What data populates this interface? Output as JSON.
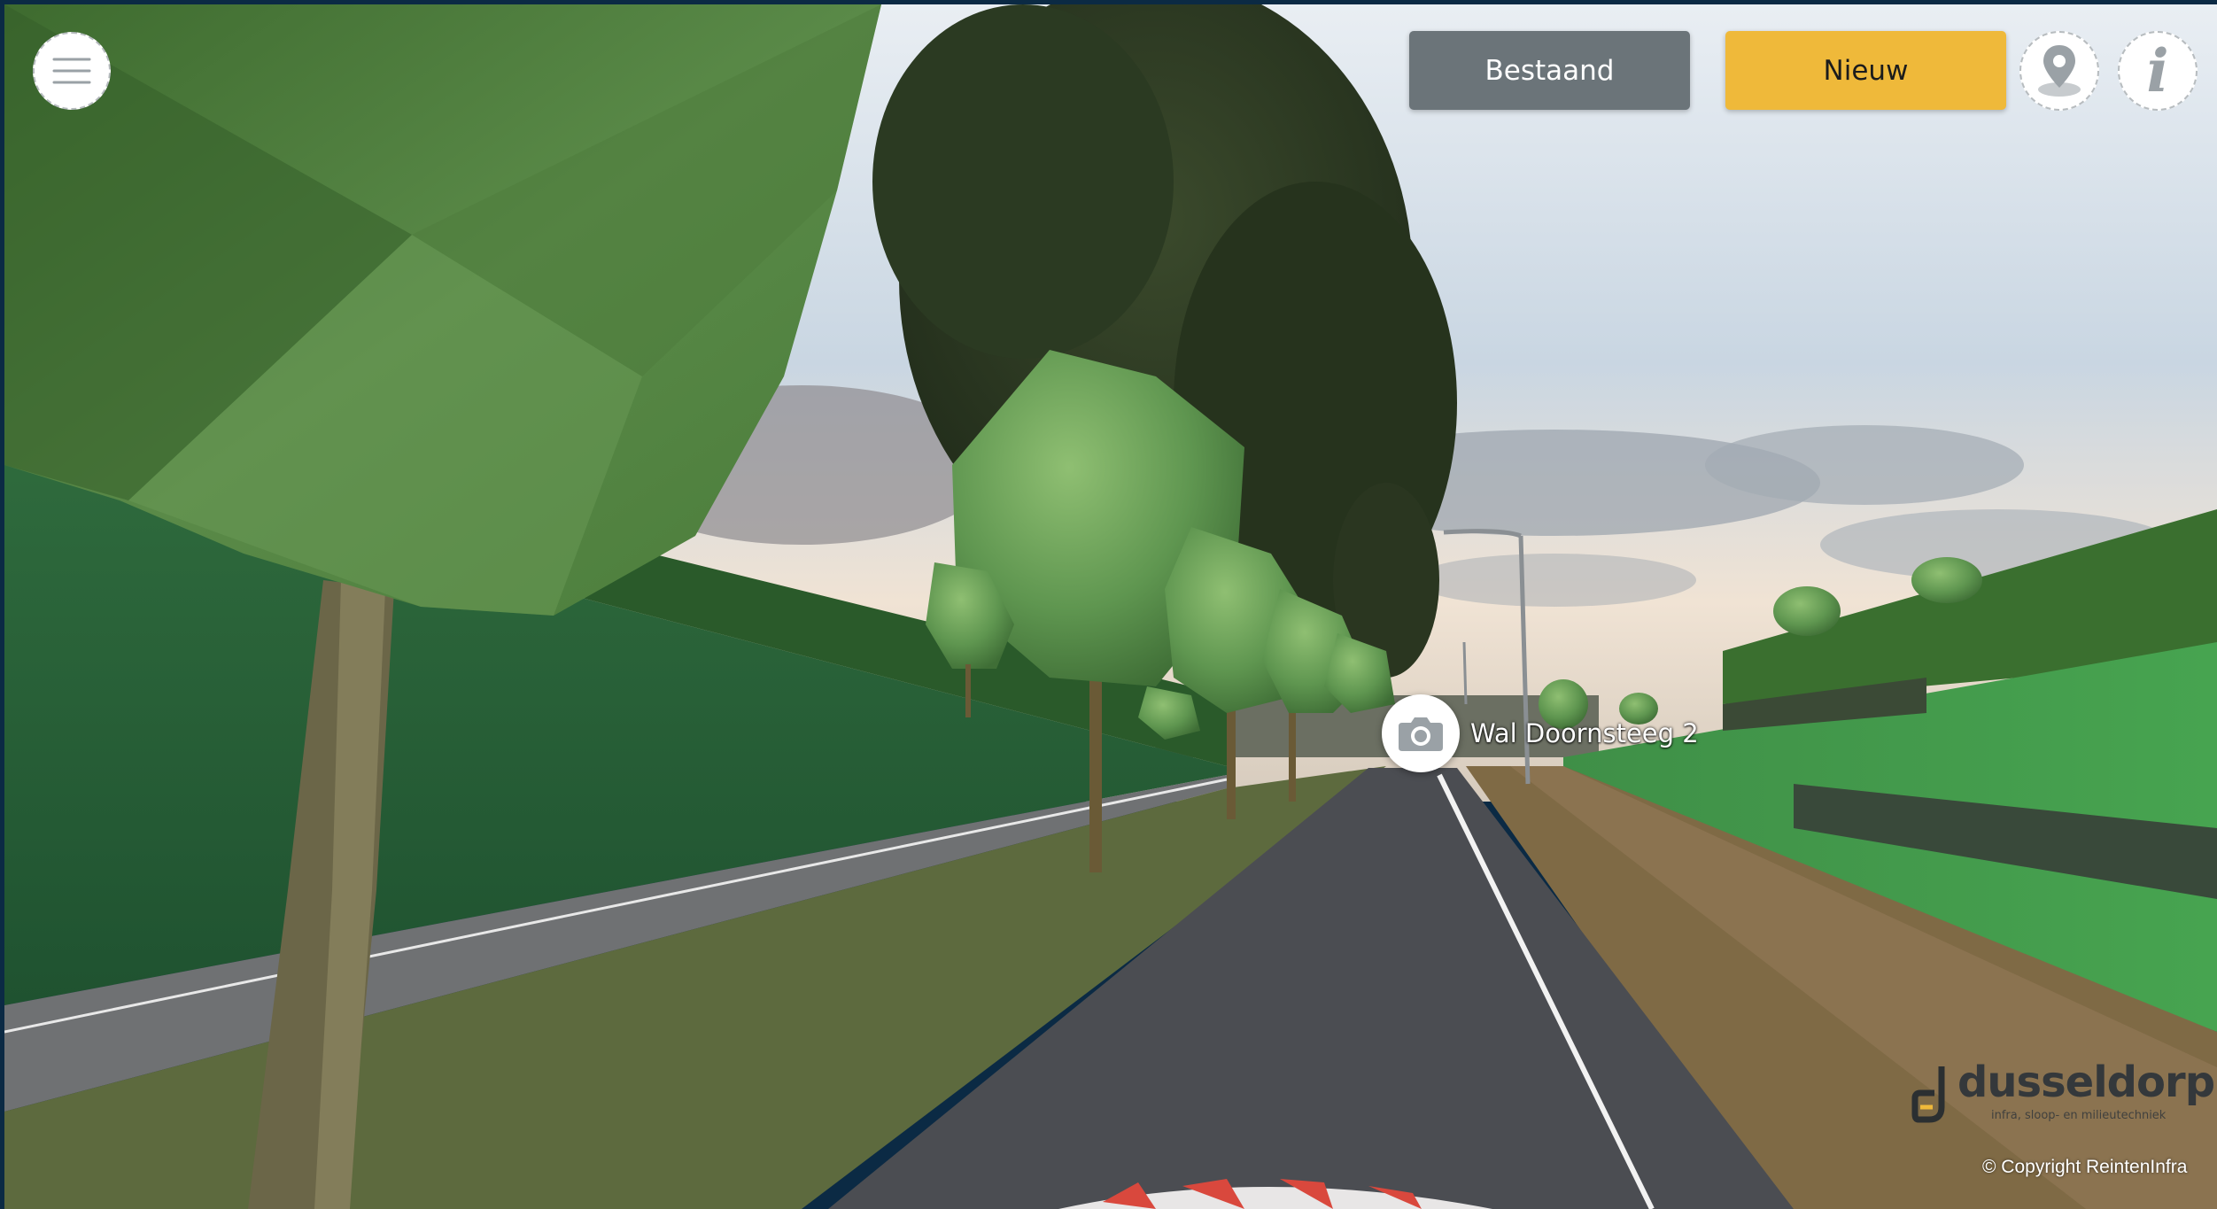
{
  "toolbar": {
    "existing_label": "Bestaand",
    "new_label": "Nieuw",
    "menu_icon": "hamburger-menu-icon",
    "location_icon": "map-pin-icon",
    "info_icon": "info-icon",
    "info_glyph": "i",
    "new_color": "#efb93a",
    "existing_color": "#6b7479"
  },
  "hotspot": {
    "icon": "camera-icon",
    "label": "Wal Doornsteeg 2"
  },
  "logo": {
    "name": "dusseldorp",
    "tagline": "infra, sloop- en milieutechniek"
  },
  "footer": {
    "copyright": "© Copyright ReintenInfra"
  }
}
